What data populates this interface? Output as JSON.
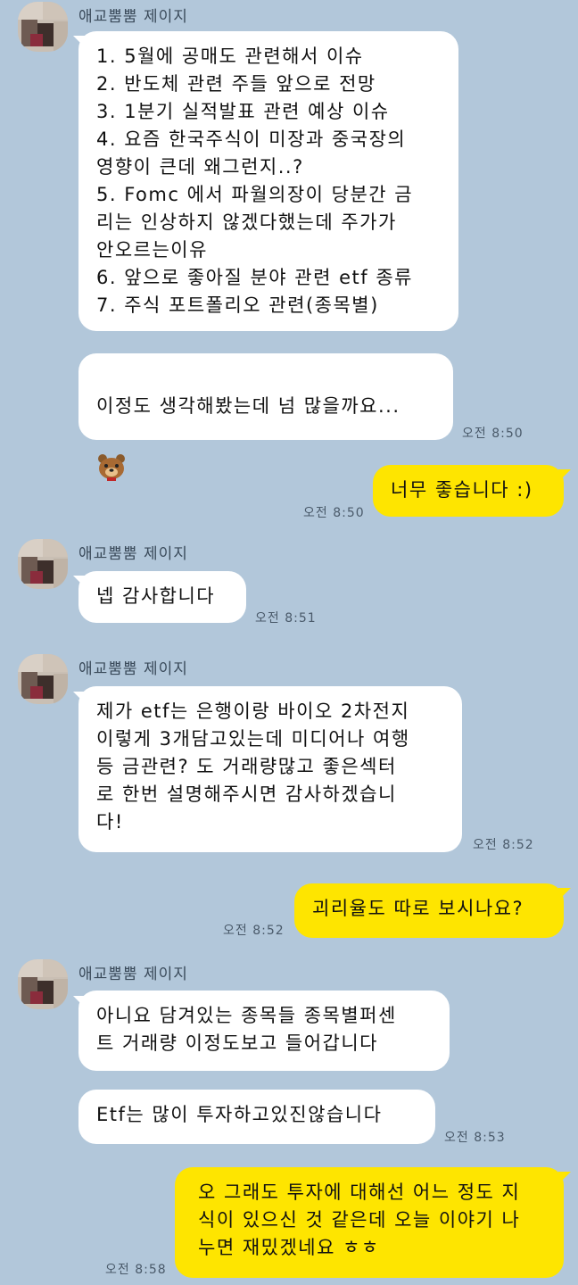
{
  "chat": {
    "sender_name": "애교뿜뿜 제이지",
    "messages": {
      "m1": "1. 5월에 공매도 관련해서 이슈\n2. 반도체 관련 주들 앞으로 전망\n3. 1분기 실적발표 관련 예상 이슈\n4. 요즘 한국주식이 미장과 중국장의\n영향이 큰데 왜그런지..?\n5. Fomc 에서 파월의장이 당분간 금\n리는 인상하지 않겠다했는데 주가가\n안오르는이유\n6. 앞으로 좋아질 분야 관련 etf 종류\n7. 주식 포트폴리오 관련(종목별)",
      "m2": "이정도 생각해봤는데 넘 많을까요...",
      "m2_time": "오전 8:50",
      "m3": "너무 좋습니다 :)",
      "m3_time": "오전 8:50",
      "m4": "넵 감사합니다",
      "m4_time": "오전 8:51",
      "m5": "제가 etf는 은행이랑 바이오 2차전지\n이렇게 3개담고있는데 미디어나 여행\n등 금관련? 도 거래량많고 좋은섹터\n로 한번 설명해주시면 감사하겠습니\n다!",
      "m5_time": "오전 8:52",
      "m6": "괴리율도 따로 보시나요?",
      "m6_time": "오전 8:52",
      "m7": "아니요 담겨있는 종목들 종목별퍼센\n트 거래량 이정도보고 들어갑니다",
      "m8": "Etf는 많이 투자하고있진않습니다",
      "m8_time": "오전 8:53",
      "m9": "오 그래도 투자에 대해선 어느 정도 지\n식이 있으신 것 같은데 오늘 이야기 나\n누면 재밌겠네요 ㅎㅎ",
      "m9_time": "오전 8:58"
    }
  },
  "icons": {
    "sticker": "bear-face-emoji-icon"
  },
  "colors": {
    "background": "#b2c7da",
    "incoming_bubble": "#ffffff",
    "outgoing_bubble": "#fee500"
  }
}
